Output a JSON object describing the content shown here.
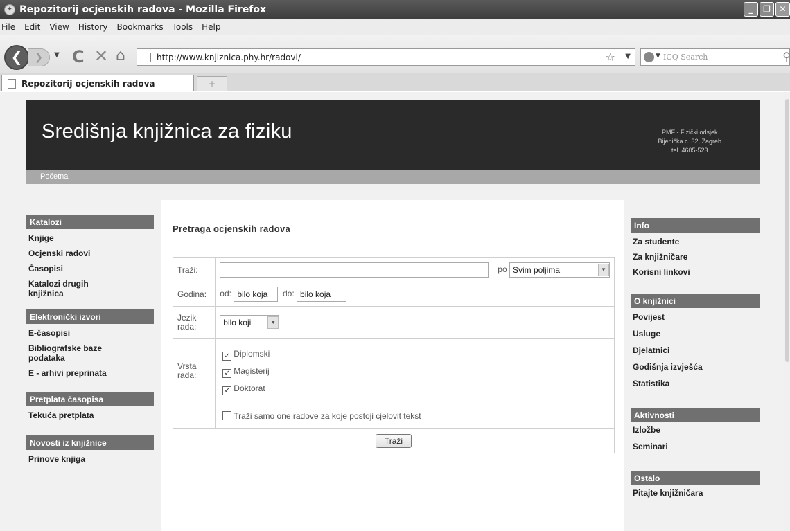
{
  "browser": {
    "title": "Repozitorij ocjenskih radova - Mozilla Firefox",
    "menu": [
      "File",
      "Edit",
      "View",
      "History",
      "Bookmarks",
      "Tools",
      "Help"
    ],
    "url": "http://www.knjiznica.phy.hr/radovi/",
    "search_placeholder": "ICQ Search",
    "tab_title": "Repozitorij ocjenskih radova",
    "new_tab": "+"
  },
  "header": {
    "title": "Središnja knjižnica za fiziku",
    "addr_line1": "PMF - Fizički odsjek",
    "addr_line2": "Bijenička c. 32, Zagreb",
    "addr_line3": "tel. 4605-523",
    "breadcrumb": "Početna"
  },
  "left_sidebar": [
    {
      "heading": "Katalozi",
      "links": [
        "Knjige",
        "Ocjenski radovi",
        "Časopisi",
        "Katalozi drugih knjižnica"
      ]
    },
    {
      "heading": "Elektronički izvori",
      "links": [
        "E-časopisi",
        "Bibliografske baze podataka",
        "E - arhivi preprinata"
      ]
    },
    {
      "heading": "Pretplata časopisa",
      "links": [
        "Tekuća pretplata"
      ]
    },
    {
      "heading": "Novosti iz knjižnice",
      "links": [
        "Prinove knjiga"
      ]
    }
  ],
  "search": {
    "title": "Pretraga ocjenskih radova",
    "trazi_label": "Traži:",
    "po_label": "po",
    "field_select": "Svim poljima",
    "godina_label": "Godina:",
    "od_label": "od:",
    "od_value": "bilo koja",
    "do_label": "do:",
    "do_value": "bilo koja",
    "jezik_label": "Jezik rada:",
    "jezik_value": "bilo koji",
    "vrsta_label": "Vrsta rada:",
    "types": [
      "Diplomski",
      "Magisterij",
      "Doktorat"
    ],
    "fulltext_label": "Traži samo one radove za koje postoji cjelovit tekst",
    "submit": "Traži"
  },
  "right_sidebar": [
    {
      "heading": "Info",
      "links": [
        "Za studente",
        "Za knjižničare",
        "Korisni linkovi"
      ]
    },
    {
      "heading": "O knjižnici",
      "links": [
        "Povijest",
        "Usluge",
        "Djelatnici",
        "Godišnja izvješća",
        "Statistika"
      ]
    },
    {
      "heading": "Aktivnosti",
      "links": [
        "Izložbe",
        "Seminari"
      ]
    },
    {
      "heading": "Ostalo",
      "links": [
        "Pitajte knjižničara"
      ]
    }
  ]
}
